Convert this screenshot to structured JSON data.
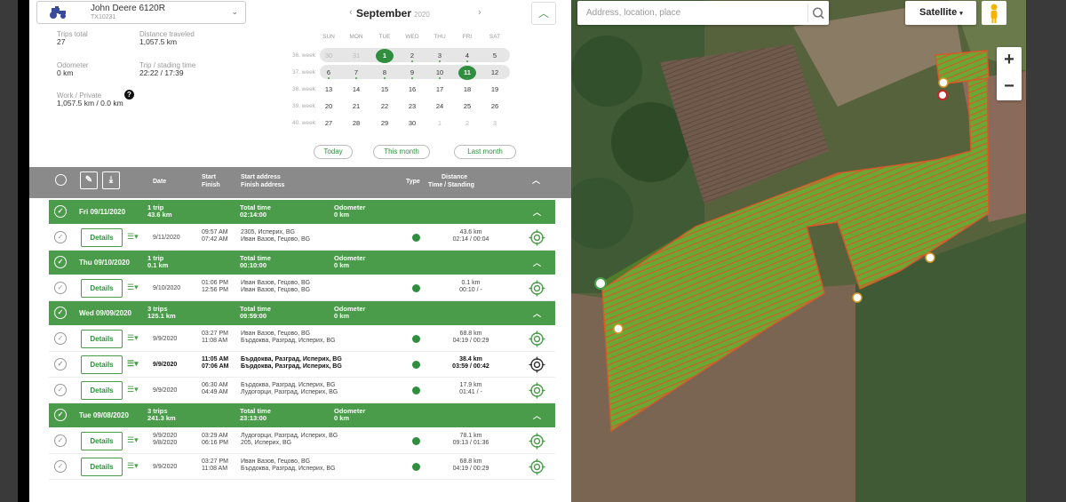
{
  "vehicle": {
    "name": "John Deere 6120R",
    "id": "TX10231"
  },
  "stats": {
    "trips_total_label": "Trips total",
    "trips_total": "27",
    "distance_label": "Distance traveled",
    "distance": "1,057.5 km",
    "odometer_label": "Odometer",
    "odometer": "0 km",
    "trip_time_label": "Trip / stading time",
    "trip_time": "22:22 / 17:39",
    "work_label": "Work / Private",
    "work": "1,057.5 km / 0.0 km"
  },
  "calendar": {
    "month": "September",
    "year": "2020",
    "prev": "‹",
    "next": "›",
    "dow": [
      "SUN",
      "MON",
      "TUE",
      "WED",
      "THU",
      "FRI",
      "SAT"
    ],
    "weeks": [
      {
        "label": "36. week",
        "days": [
          "30",
          "31",
          "1",
          "2",
          "3",
          "4",
          "5"
        ]
      },
      {
        "label": "37. week",
        "days": [
          "6",
          "7",
          "8",
          "9",
          "10",
          "11",
          "12"
        ]
      },
      {
        "label": "38. week",
        "days": [
          "13",
          "14",
          "15",
          "16",
          "17",
          "18",
          "19"
        ]
      },
      {
        "label": "39. week",
        "days": [
          "20",
          "21",
          "22",
          "23",
          "24",
          "25",
          "26"
        ]
      },
      {
        "label": "40. week",
        "days": [
          "27",
          "28",
          "29",
          "30",
          "1",
          "2",
          "3"
        ]
      }
    ],
    "today_btn": "Today",
    "month_btn": "This month",
    "last_month_btn": "Last month"
  },
  "table_header": {
    "date": "Date",
    "start": "Start",
    "finish": "Finish",
    "start_addr": "Start address",
    "finish_addr": "Finish address",
    "type": "Type",
    "distance": "Distance",
    "time_standing": "Time / Standing"
  },
  "groups": [
    {
      "date": "Fri 09/11/2020",
      "trips": "1 trip",
      "km": "43.6 km",
      "total_time": "02:14:00",
      "odometer": "0 km",
      "rows": [
        {
          "date": "9/11/2020",
          "start_t": "09:57 AM",
          "end_t": "07:42 AM",
          "start_addr": "2305, Исперих, BG",
          "end_addr": "Иван Вазов, Гецово, BG",
          "dist": "43.6 km",
          "time": "02:14 / 00:04",
          "bold": false
        }
      ]
    },
    {
      "date": "Thu 09/10/2020",
      "trips": "1 trip",
      "km": "0.1 km",
      "total_time": "00:10:00",
      "odometer": "0 km",
      "rows": [
        {
          "date": "9/10/2020",
          "start_t": "01:06 PM",
          "end_t": "12:56 PM",
          "start_addr": "Иван Вазов, Гецово, BG",
          "end_addr": "Иван Вазов, Гецово, BG",
          "dist": "0.1 km",
          "time": "00:10 / -",
          "bold": false
        }
      ]
    },
    {
      "date": "Wed 09/09/2020",
      "trips": "3 trips",
      "km": "125.1 km",
      "total_time": "09:59:00",
      "odometer": "0 km",
      "rows": [
        {
          "date": "9/9/2020",
          "start_t": "03:27 PM",
          "end_t": "11:08 AM",
          "start_addr": "Иван Вазов, Гецово, BG",
          "end_addr": "Бърдоква, Разград, Исперих, BG",
          "dist": "68.8 km",
          "time": "04:19 / 00:29",
          "bold": false
        },
        {
          "date": "9/9/2020",
          "start_t": "11:05 AM",
          "end_t": "07:06 AM",
          "start_addr": "Бърдоква, Разград, Исперих, BG",
          "end_addr": "Бърдоква, Разград, Исперих, BG",
          "dist": "38.4 km",
          "time": "03:59 / 00:42",
          "bold": true
        },
        {
          "date": "9/9/2020",
          "start_t": "06:30 AM",
          "end_t": "04:49 AM",
          "start_addr": "Бърдоква, Разград, Исперих, BG",
          "end_addr": "Лудогорци, Разград, Исперих, BG",
          "dist": "17.9 km",
          "time": "01:41 / -",
          "bold": false
        }
      ]
    },
    {
      "date": "Tue 09/08/2020",
      "trips": "3 trips",
      "km": "241.3 km",
      "total_time": "23:13:00",
      "odometer": "0 km",
      "rows": [
        {
          "date2": "9/9/2020",
          "date": "9/8/2020",
          "start_t": "03:29 AM",
          "end_t": "06:16 PM",
          "start_addr": "Лудогорци, Разград, Исперих, BG",
          "end_addr": "205, Исперих, BG",
          "dist": "78.1 km",
          "time": "09:13 / 01:36",
          "bold": false
        },
        {
          "date": "9/9/2020",
          "start_t": "03:27 PM",
          "end_t": "11:08 AM",
          "start_addr": "Иван Вазов, Гецово, BG",
          "end_addr": "Бърдоква, Разград, Исперих, BG",
          "dist": "68.8 km",
          "time": "04:19 / 00:29",
          "bold": false
        }
      ]
    }
  ],
  "labels": {
    "total_time": "Total time",
    "odometer": "Odometer",
    "details": "Details"
  },
  "map": {
    "search_placeholder": "Address, location, place",
    "map_type": "Satellite",
    "zoom_in": "+",
    "zoom_out": "−"
  },
  "colors": {
    "accent": "#4a9b4a",
    "accent_dark": "#2f8f3e",
    "header_gray": "#8a8a8a"
  }
}
